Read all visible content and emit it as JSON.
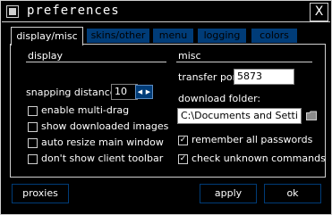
{
  "window": {
    "title": "preferences",
    "close_symbol": "X"
  },
  "tabs": [
    {
      "label": "display/misc",
      "active": true
    },
    {
      "label": "skins/other",
      "active": false
    },
    {
      "label": "menu",
      "active": false
    },
    {
      "label": "logging",
      "active": false
    },
    {
      "label": "colors",
      "active": false
    }
  ],
  "display": {
    "heading": "display",
    "snapping_label": "snapping distance:",
    "snapping_value": "10",
    "options": [
      {
        "label": "enable multi-drag",
        "checked": false
      },
      {
        "label": "show downloaded images",
        "checked": false
      },
      {
        "label": "auto resize main window",
        "checked": false
      },
      {
        "label": "don't show client toolbar",
        "checked": false
      }
    ]
  },
  "misc": {
    "heading": "misc",
    "transfer_port_label": "transfer port:",
    "transfer_port_value": "5873",
    "download_folder_label": "download folder:",
    "download_folder_value": "C:\\Documents and Setti",
    "options": [
      {
        "label": "remember all passwords",
        "checked": true
      },
      {
        "label": "check unknown commands",
        "checked": true
      }
    ]
  },
  "buttons": {
    "proxies": "proxies",
    "apply": "apply",
    "ok": "ok"
  },
  "colors": {
    "accent": "#003c78",
    "border": "#cfcfcf",
    "background": "#000000",
    "text": "#ffffff"
  }
}
